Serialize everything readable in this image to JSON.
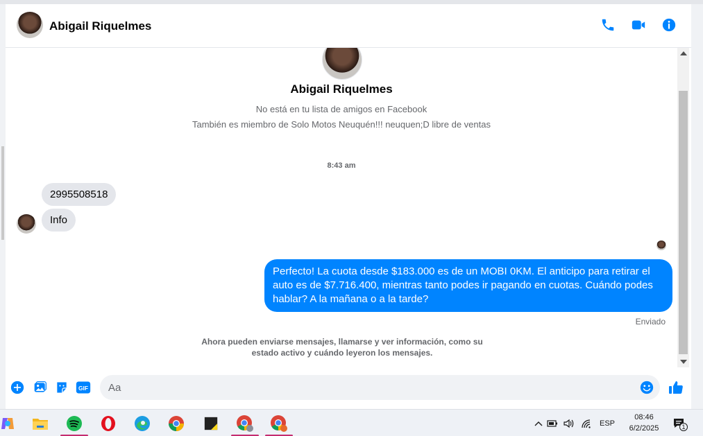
{
  "header": {
    "contact_name": "Abigail Riquelmes",
    "icons": [
      "phone-icon",
      "video-camera-icon",
      "info-icon"
    ],
    "accent_color": "#0084ff"
  },
  "profile": {
    "name": "Abigail Riquelmes",
    "line1": "No está en tu lista de amigos en Facebook",
    "line2": "También es miembro de Solo Motos Neuquén!!! neuquen;D libre de ventas"
  },
  "conversation": {
    "timestamp": "8:43 am",
    "incoming": [
      {
        "text": "2995508518"
      },
      {
        "text": "Info"
      }
    ],
    "outgoing": {
      "text": "Perfecto! La cuota desde $183.000 es de un MOBI 0KM. El anticipo para retirar el auto es de $7.716.400, mientras tanto podes ir pagando en cuotas. Cuándo podes hablar? A la mañana o a la tarde?",
      "status": "Enviado"
    },
    "notice": "Ahora pueden enviarse mensajes, llamarse y ver información, como su estado activo y cuándo leyeron los mensajes."
  },
  "composer": {
    "placeholder": "Aa",
    "gif_label": "GIF",
    "icons": [
      "plus-circle-icon",
      "image-icon",
      "sticker-icon",
      "gif-icon",
      "emoji-icon",
      "like-thumb-icon"
    ]
  },
  "taskbar": {
    "apps": [
      "copilot-icon",
      "file-explorer-icon",
      "spotify-icon",
      "opera-icon",
      "edge-icon",
      "chrome-icon",
      "sticky-notes-icon",
      "chrome-profile-a-icon",
      "chrome-profile-b-icon"
    ],
    "language": "ESP",
    "time": "08:46",
    "date": "6/2/2025",
    "notification_count": "1"
  }
}
